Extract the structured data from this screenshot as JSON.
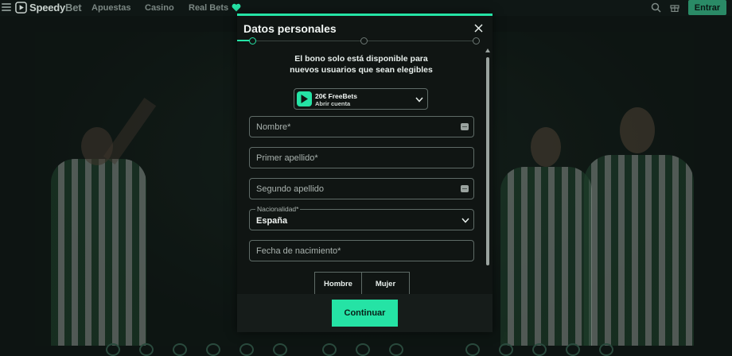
{
  "header": {
    "logo": {
      "part1": "Speedy",
      "part2": "Bet"
    },
    "nav": [
      "Apuestas",
      "Casino",
      "Real Bets"
    ],
    "login_label": "Entrar"
  },
  "modal": {
    "title": "Datos personales",
    "steps_total": 3,
    "current_step": 1,
    "bonus_notice": "El bono solo está disponible para nuevos usuarios que sean elegibles",
    "promo": {
      "title": "20€ FreeBets",
      "subtitle": "Abrir cuenta"
    },
    "fields": {
      "nombre": {
        "placeholder": "Nombre*"
      },
      "primer_apellido": {
        "placeholder": "Primer apellido*"
      },
      "segundo_apellido": {
        "placeholder": "Segundo apellido"
      },
      "nacionalidad": {
        "label": "Nacionalidad*",
        "value": "España"
      },
      "fecha_nacimiento": {
        "placeholder": "Fecha de nacimiento*"
      }
    },
    "gender_options": [
      "Hombre",
      "Mujer"
    ],
    "continue_label": "Continuar"
  },
  "colors": {
    "accent": "#25e3a5",
    "entrar_button": "#2a8a66",
    "background": "#0d1412"
  }
}
